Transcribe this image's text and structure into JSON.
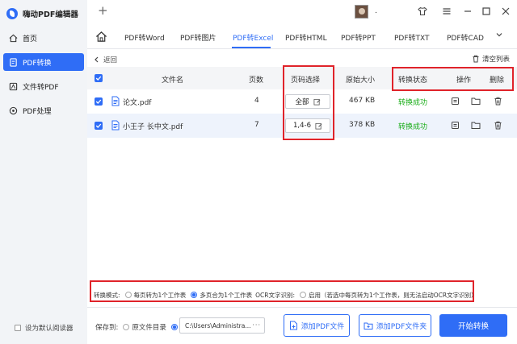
{
  "app": {
    "title": "嗨动PDF编辑器"
  },
  "sidebar": {
    "items": [
      {
        "label": "首页",
        "icon": "home-icon",
        "active": false
      },
      {
        "label": "PDF转换",
        "icon": "document-convert-icon",
        "active": true
      },
      {
        "label": "文件转PDF",
        "icon": "file-to-pdf-icon",
        "active": false
      },
      {
        "label": "PDF处理",
        "icon": "pdf-process-icon",
        "active": false
      }
    ],
    "default_reader_label": "设为默认阅读器"
  },
  "titlebar": {
    "user_name": ".",
    "icons": [
      "shirt-icon",
      "menu-icon",
      "minimize-icon",
      "maximize-icon",
      "close-icon"
    ]
  },
  "tabs": [
    {
      "label": "PDF转Word"
    },
    {
      "label": "PDF转图片"
    },
    {
      "label": "PDF转Excel",
      "active": true
    },
    {
      "label": "PDF转HTML"
    },
    {
      "label": "PDF转PPT"
    },
    {
      "label": "PDF转TXT"
    },
    {
      "label": "PDF转CAD"
    }
  ],
  "toolbar": {
    "back_label": "返回",
    "clear_label": "清空列表"
  },
  "table": {
    "headers": {
      "filename": "文件名",
      "pages": "页数",
      "page_select": "页码选择",
      "original_size": "原始大小",
      "status": "转换状态",
      "actions": "操作",
      "delete": "删除"
    },
    "rows": [
      {
        "filename": "论文.pdf",
        "pages": "4",
        "page_select": "全部",
        "size": "467 KB",
        "status": "转换成功",
        "checked": true
      },
      {
        "filename": "小王子 长中文.pdf",
        "pages": "7",
        "page_select": "1,4-6",
        "size": "378 KB",
        "status": "转换成功",
        "checked": true
      }
    ]
  },
  "conversion_mode": {
    "label": "转换模式:",
    "option1": "每页转为1个工作表",
    "option2": "多页合为1个工作表",
    "ocr_label": "OCR文字识别:",
    "ocr_option": "启用（若选中每页转为1个工作表，则无法启动OCR文字识别）",
    "selected": "option2"
  },
  "bottom": {
    "save_to_label": "保存到:",
    "original_dir_label": "原文件目录",
    "path_value": "C:\\Users\\Administra...",
    "path_more": "···",
    "add_file_label": "添加PDF文件",
    "add_folder_label": "添加PDF文件夹",
    "start_label": "开始转换",
    "save_option_selected": "custom"
  },
  "colors": {
    "accent": "#2f6df6",
    "success": "#1aad19",
    "highlight": "#e0232a"
  }
}
